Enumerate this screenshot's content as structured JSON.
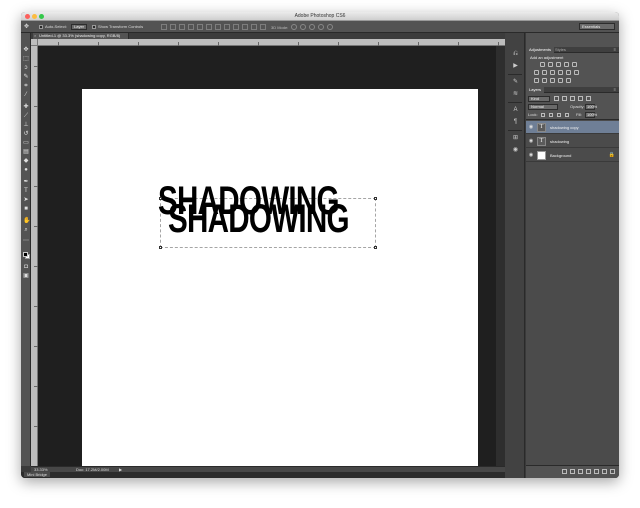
{
  "window": {
    "title": "Adobe Photoshop CS6"
  },
  "options_bar": {
    "auto_select_label": "Auto-Select:",
    "auto_select_value": "Layer",
    "show_transform_label": "Show Transform Controls",
    "mode_3d_label": "3D Mode:",
    "workspace": "Essentials"
  },
  "document": {
    "tab_title": "Untitled-1 @ 33.3% (shadowing copy, RGB/8)",
    "front_text": "SHADOWING",
    "shadow_text": "SHADOWING",
    "zoom": "33.33%",
    "doc_size": "Doc: 17.2M/2.00M",
    "status_arrow": "▶"
  },
  "mini_bridge": {
    "label": "Mini Bridge"
  },
  "adjustments_panel": {
    "tab_active": "Adjustments",
    "tab_inactive": "Styles",
    "title": "Add an adjustment"
  },
  "layers_panel": {
    "tab": "Layers",
    "kind_filter": "Kind",
    "blend_mode": "Normal",
    "opacity_label": "Opacity:",
    "opacity_value": "100%",
    "lock_label": "Lock:",
    "fill_label": "Fill:",
    "fill_value": "100%",
    "layers": [
      {
        "name": "shadowing copy",
        "type": "text",
        "selected": true
      },
      {
        "name": "shadowing",
        "type": "text",
        "selected": false
      },
      {
        "name": "Background",
        "type": "raster",
        "selected": false
      }
    ]
  },
  "colors": {
    "selection": "#6f7f96",
    "foreground": "#000000",
    "background": "#ffffff"
  }
}
